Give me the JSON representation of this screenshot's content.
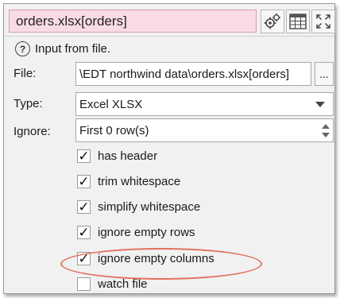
{
  "title": "orders.xlsx[orders]",
  "toolbar": {
    "settings_icon": "gears-icon",
    "table_icon": "table-icon",
    "maximize_icon": "maximize-icon"
  },
  "help": {
    "icon": "question-mark",
    "text": "Input from file."
  },
  "file": {
    "label": "File:",
    "value": "\\EDT northwind data\\orders.xlsx[orders]",
    "browse_label": "..."
  },
  "type": {
    "label": "Type:",
    "value": "Excel XLSX"
  },
  "ignore": {
    "label": "Ignore:",
    "value": "First 0 row(s)"
  },
  "options": [
    {
      "label": "has header",
      "checked": true,
      "check_mark": "✓"
    },
    {
      "label": "trim whitespace",
      "checked": true,
      "check_mark": "✓"
    },
    {
      "label": "simplify whitespace",
      "checked": true,
      "check_mark": "✓"
    },
    {
      "label": "ignore empty rows",
      "checked": true,
      "check_mark": "✓"
    },
    {
      "label": "ignore empty columns",
      "checked": true,
      "check_mark": "✓"
    },
    {
      "label": "watch file",
      "checked": false,
      "check_mark": ""
    }
  ],
  "colors": {
    "title_bg": "#f9dbe6",
    "highlight_ellipse": "#e2705f"
  }
}
